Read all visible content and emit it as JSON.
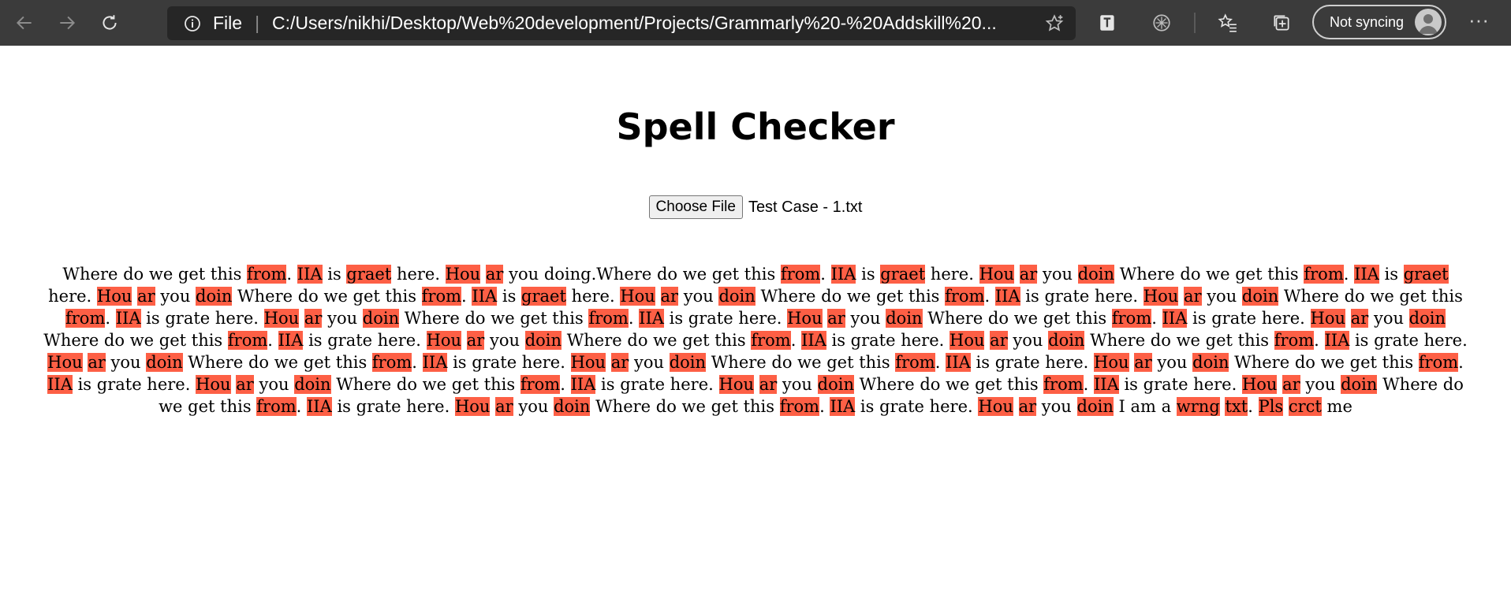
{
  "browser": {
    "address_scheme": "File",
    "address_url": "C:/Users/nikhi/Desktop/Web%20development/Projects/Grammarly%20-%20Addskill%20...",
    "sync_label": "Not syncing",
    "more_label": "···"
  },
  "page": {
    "title": "Spell Checker",
    "file_button": "Choose File",
    "file_name": "Test Case - 1.txt"
  },
  "result_segments": [
    {
      "t": "Where do we get this ",
      "e": false
    },
    {
      "t": "from",
      "e": true
    },
    {
      "t": ". ",
      "e": false
    },
    {
      "t": "IIA",
      "e": true
    },
    {
      "t": " is ",
      "e": false
    },
    {
      "t": "graet",
      "e": true
    },
    {
      "t": " here. ",
      "e": false
    },
    {
      "t": "Hou",
      "e": true
    },
    {
      "t": " ",
      "e": false
    },
    {
      "t": "ar",
      "e": true
    },
    {
      "t": " you doing.Where do we get this ",
      "e": false
    },
    {
      "t": "from",
      "e": true
    },
    {
      "t": ". ",
      "e": false
    },
    {
      "t": "IIA",
      "e": true
    },
    {
      "t": " is ",
      "e": false
    },
    {
      "t": "graet",
      "e": true
    },
    {
      "t": " here. ",
      "e": false
    },
    {
      "t": "Hou",
      "e": true
    },
    {
      "t": " ",
      "e": false
    },
    {
      "t": "ar",
      "e": true
    },
    {
      "t": " you ",
      "e": false
    },
    {
      "t": "doin",
      "e": true
    },
    {
      "t": " Where do we get this ",
      "e": false
    },
    {
      "t": "from",
      "e": true
    },
    {
      "t": ". ",
      "e": false
    },
    {
      "t": "IIA",
      "e": true
    },
    {
      "t": " is ",
      "e": false
    },
    {
      "t": "graet",
      "e": true
    },
    {
      "t": " here. ",
      "e": false
    },
    {
      "t": "Hou",
      "e": true
    },
    {
      "t": " ",
      "e": false
    },
    {
      "t": "ar",
      "e": true
    },
    {
      "t": " you ",
      "e": false
    },
    {
      "t": "doin",
      "e": true
    },
    {
      "t": " Where do we get this ",
      "e": false
    },
    {
      "t": "from",
      "e": true
    },
    {
      "t": ". ",
      "e": false
    },
    {
      "t": "IIA",
      "e": true
    },
    {
      "t": " is ",
      "e": false
    },
    {
      "t": "graet",
      "e": true
    },
    {
      "t": " here. ",
      "e": false
    },
    {
      "t": "Hou",
      "e": true
    },
    {
      "t": " ",
      "e": false
    },
    {
      "t": "ar",
      "e": true
    },
    {
      "t": " you ",
      "e": false
    },
    {
      "t": "doin",
      "e": true
    },
    {
      "t": " Where do we get this ",
      "e": false
    },
    {
      "t": "from",
      "e": true
    },
    {
      "t": ". ",
      "e": false
    },
    {
      "t": "IIA",
      "e": true
    },
    {
      "t": " is grate here. ",
      "e": false
    },
    {
      "t": "Hou",
      "e": true
    },
    {
      "t": " ",
      "e": false
    },
    {
      "t": "ar",
      "e": true
    },
    {
      "t": " you ",
      "e": false
    },
    {
      "t": "doin",
      "e": true
    },
    {
      "t": " Where do we get this ",
      "e": false
    },
    {
      "t": "from",
      "e": true
    },
    {
      "t": ". ",
      "e": false
    },
    {
      "t": "IIA",
      "e": true
    },
    {
      "t": " is grate here. ",
      "e": false
    },
    {
      "t": "Hou",
      "e": true
    },
    {
      "t": " ",
      "e": false
    },
    {
      "t": "ar",
      "e": true
    },
    {
      "t": " you ",
      "e": false
    },
    {
      "t": "doin",
      "e": true
    },
    {
      "t": " Where do we get this ",
      "e": false
    },
    {
      "t": "from",
      "e": true
    },
    {
      "t": ". ",
      "e": false
    },
    {
      "t": "IIA",
      "e": true
    },
    {
      "t": " is grate here. ",
      "e": false
    },
    {
      "t": "Hou",
      "e": true
    },
    {
      "t": " ",
      "e": false
    },
    {
      "t": "ar",
      "e": true
    },
    {
      "t": " you ",
      "e": false
    },
    {
      "t": "doin",
      "e": true
    },
    {
      "t": " Where do we get this ",
      "e": false
    },
    {
      "t": "from",
      "e": true
    },
    {
      "t": ". ",
      "e": false
    },
    {
      "t": "IIA",
      "e": true
    },
    {
      "t": " is grate here. ",
      "e": false
    },
    {
      "t": "Hou",
      "e": true
    },
    {
      "t": " ",
      "e": false
    },
    {
      "t": "ar",
      "e": true
    },
    {
      "t": " you ",
      "e": false
    },
    {
      "t": "doin",
      "e": true
    },
    {
      "t": " Where do we get this ",
      "e": false
    },
    {
      "t": "from",
      "e": true
    },
    {
      "t": ". ",
      "e": false
    },
    {
      "t": "IIA",
      "e": true
    },
    {
      "t": " is grate here. ",
      "e": false
    },
    {
      "t": "Hou",
      "e": true
    },
    {
      "t": " ",
      "e": false
    },
    {
      "t": "ar",
      "e": true
    },
    {
      "t": " you ",
      "e": false
    },
    {
      "t": "doin",
      "e": true
    },
    {
      "t": " Where do we get this ",
      "e": false
    },
    {
      "t": "from",
      "e": true
    },
    {
      "t": ". ",
      "e": false
    },
    {
      "t": "IIA",
      "e": true
    },
    {
      "t": " is grate here. ",
      "e": false
    },
    {
      "t": "Hou",
      "e": true
    },
    {
      "t": " ",
      "e": false
    },
    {
      "t": "ar",
      "e": true
    },
    {
      "t": " you ",
      "e": false
    },
    {
      "t": "doin",
      "e": true
    },
    {
      "t": " Where do we get this ",
      "e": false
    },
    {
      "t": "from",
      "e": true
    },
    {
      "t": ". ",
      "e": false
    },
    {
      "t": "IIA",
      "e": true
    },
    {
      "t": " is grate here. ",
      "e": false
    },
    {
      "t": "Hou",
      "e": true
    },
    {
      "t": " ",
      "e": false
    },
    {
      "t": "ar",
      "e": true
    },
    {
      "t": " you ",
      "e": false
    },
    {
      "t": "doin",
      "e": true
    },
    {
      "t": " Where do we get this ",
      "e": false
    },
    {
      "t": "from",
      "e": true
    },
    {
      "t": ". ",
      "e": false
    },
    {
      "t": "IIA",
      "e": true
    },
    {
      "t": " is grate here. ",
      "e": false
    },
    {
      "t": "Hou",
      "e": true
    },
    {
      "t": " ",
      "e": false
    },
    {
      "t": "ar",
      "e": true
    },
    {
      "t": " you ",
      "e": false
    },
    {
      "t": "doin",
      "e": true
    },
    {
      "t": " Where do we get this ",
      "e": false
    },
    {
      "t": "from",
      "e": true
    },
    {
      "t": ". ",
      "e": false
    },
    {
      "t": "IIA",
      "e": true
    },
    {
      "t": " is grate here. ",
      "e": false
    },
    {
      "t": "Hou",
      "e": true
    },
    {
      "t": " ",
      "e": false
    },
    {
      "t": "ar",
      "e": true
    },
    {
      "t": " you ",
      "e": false
    },
    {
      "t": "doin",
      "e": true
    },
    {
      "t": " Where do we get this ",
      "e": false
    },
    {
      "t": "from",
      "e": true
    },
    {
      "t": ". ",
      "e": false
    },
    {
      "t": "IIA",
      "e": true
    },
    {
      "t": " is grate here. ",
      "e": false
    },
    {
      "t": "Hou",
      "e": true
    },
    {
      "t": " ",
      "e": false
    },
    {
      "t": "ar",
      "e": true
    },
    {
      "t": " you ",
      "e": false
    },
    {
      "t": "doin",
      "e": true
    },
    {
      "t": " Where do we get this ",
      "e": false
    },
    {
      "t": "from",
      "e": true
    },
    {
      "t": ". ",
      "e": false
    },
    {
      "t": "IIA",
      "e": true
    },
    {
      "t": " is grate here. ",
      "e": false
    },
    {
      "t": "Hou",
      "e": true
    },
    {
      "t": " ",
      "e": false
    },
    {
      "t": "ar",
      "e": true
    },
    {
      "t": " you ",
      "e": false
    },
    {
      "t": "doin",
      "e": true
    },
    {
      "t": " Where do we get this ",
      "e": false
    },
    {
      "t": "from",
      "e": true
    },
    {
      "t": ". ",
      "e": false
    },
    {
      "t": "IIA",
      "e": true
    },
    {
      "t": " is grate here. ",
      "e": false
    },
    {
      "t": "Hou",
      "e": true
    },
    {
      "t": " ",
      "e": false
    },
    {
      "t": "ar",
      "e": true
    },
    {
      "t": " you ",
      "e": false
    },
    {
      "t": "doin",
      "e": true
    },
    {
      "t": " Where do we get this ",
      "e": false
    },
    {
      "t": "from",
      "e": true
    },
    {
      "t": ". ",
      "e": false
    },
    {
      "t": "IIA",
      "e": true
    },
    {
      "t": " is grate here. ",
      "e": false
    },
    {
      "t": "Hou",
      "e": true
    },
    {
      "t": " ",
      "e": false
    },
    {
      "t": "ar",
      "e": true
    },
    {
      "t": " you ",
      "e": false
    },
    {
      "t": "doin",
      "e": true
    },
    {
      "t": " Where do we get this ",
      "e": false
    },
    {
      "t": "from",
      "e": true
    },
    {
      "t": ". ",
      "e": false
    },
    {
      "t": "IIA",
      "e": true
    },
    {
      "t": " is grate here. ",
      "e": false
    },
    {
      "t": "Hou",
      "e": true
    },
    {
      "t": " ",
      "e": false
    },
    {
      "t": "ar",
      "e": true
    },
    {
      "t": " you ",
      "e": false
    },
    {
      "t": "doin",
      "e": true
    },
    {
      "t": " I am a ",
      "e": false
    },
    {
      "t": "wrng",
      "e": true
    },
    {
      "t": " ",
      "e": false
    },
    {
      "t": "txt",
      "e": true
    },
    {
      "t": ". ",
      "e": false
    },
    {
      "t": "Pls",
      "e": true
    },
    {
      "t": " ",
      "e": false
    },
    {
      "t": "crct",
      "e": true
    },
    {
      "t": " me",
      "e": false
    }
  ],
  "colors": {
    "browser_bar": "#3b3b3b",
    "address_bg": "#262626",
    "highlight": "#fd5f45"
  },
  "icons": [
    "back-icon",
    "forward-icon",
    "refresh-icon",
    "info-icon",
    "star-icon",
    "translate-icon",
    "extension-icon",
    "favorites-icon",
    "collections-icon",
    "profile-icon",
    "more-icon"
  ]
}
